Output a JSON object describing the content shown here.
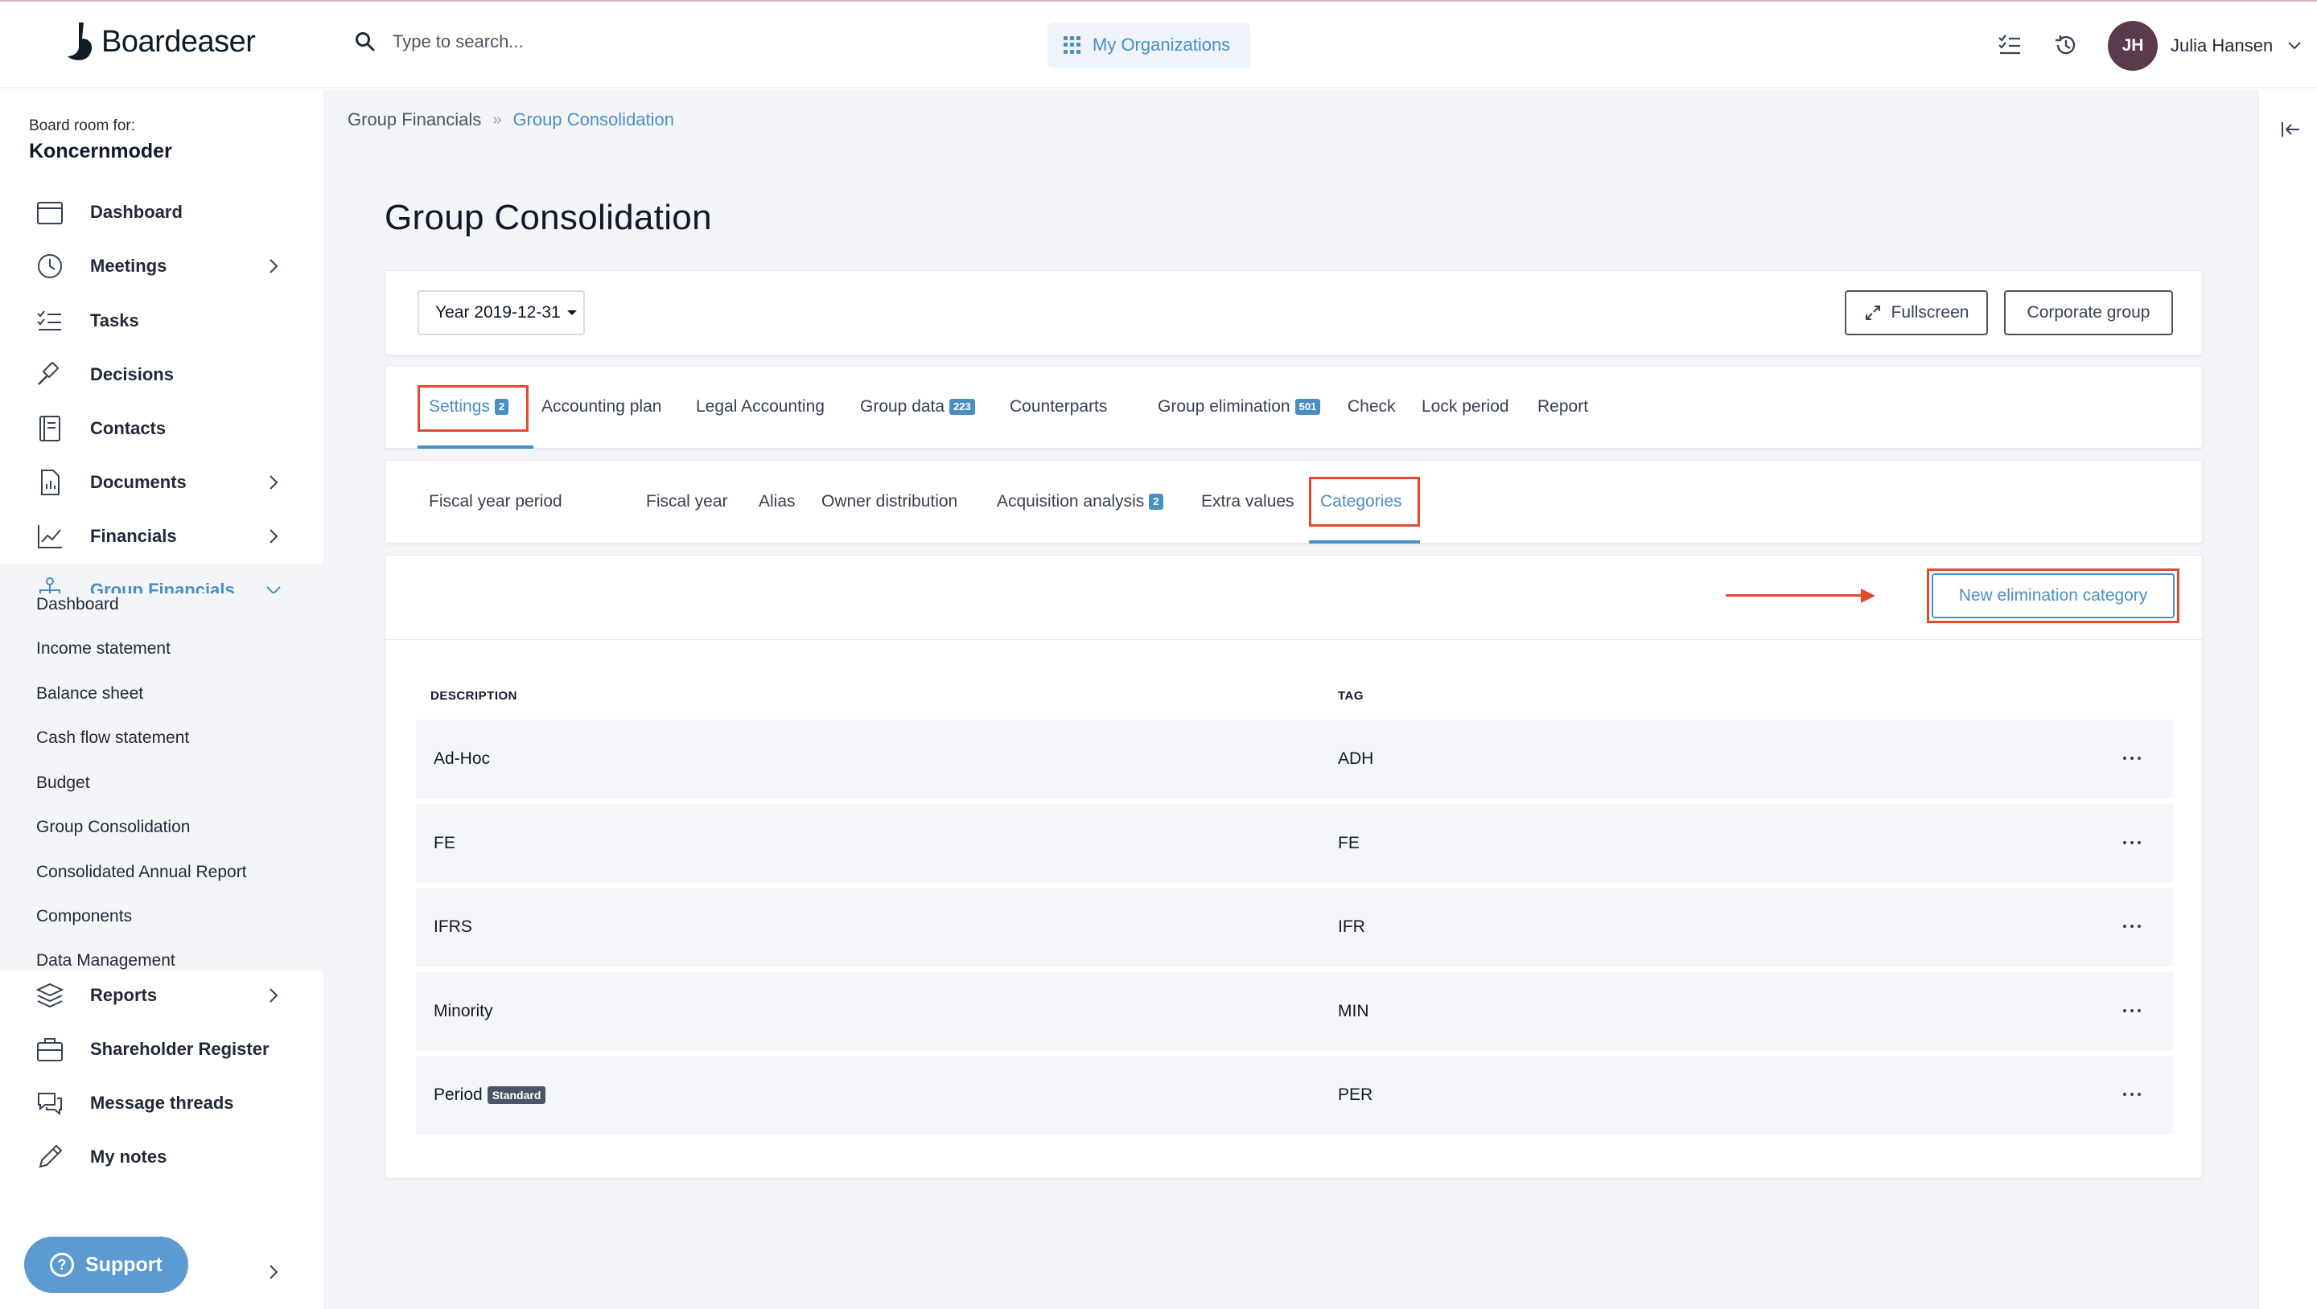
{
  "app": {
    "logo_text": "Boardeaser"
  },
  "search": {
    "placeholder": "Type to search..."
  },
  "header": {
    "orgs_label": "My Organizations",
    "user_initials": "JH",
    "user_name": "Julia Hansen"
  },
  "sidebar": {
    "board_room_label": "Board room for:",
    "org_name": "Koncernmoder",
    "items": [
      {
        "label": "Dashboard",
        "icon": "calendar-icon"
      },
      {
        "label": "Meetings",
        "icon": "clock-icon"
      },
      {
        "label": "Tasks",
        "icon": "checklist-icon"
      },
      {
        "label": "Decisions",
        "icon": "gavel-icon"
      },
      {
        "label": "Contacts",
        "icon": "address-book-icon"
      },
      {
        "label": "Documents",
        "icon": "document-icon"
      },
      {
        "label": "Financials",
        "icon": "line-chart-icon"
      },
      {
        "label": "Group Financials",
        "icon": "org-chart-icon"
      },
      {
        "label": "Reports",
        "icon": "layers-icon"
      },
      {
        "label": "Shareholder Register",
        "icon": "briefcase-icon"
      },
      {
        "label": "Message threads",
        "icon": "chat-icon"
      },
      {
        "label": "My notes",
        "icon": "pencil-icon"
      }
    ],
    "sub_items": [
      "Dashboard",
      "Income statement",
      "Balance sheet",
      "Cash flow statement",
      "Budget",
      "Group Consolidation",
      "Consolidated Annual Report",
      "Components",
      "Data Management"
    ],
    "support_label": "Support"
  },
  "breadcrumb": {
    "parent": "Group Financials",
    "current": "Group Consolidation"
  },
  "page": {
    "title": "Group Consolidation"
  },
  "toolbar": {
    "year_select": "Year 2019-12-31",
    "fullscreen_label": "Fullscreen",
    "corporate_group_label": "Corporate group"
  },
  "tabs": [
    {
      "label": "Settings",
      "badge": "2"
    },
    {
      "label": "Accounting plan"
    },
    {
      "label": "Legal Accounting"
    },
    {
      "label": "Group data",
      "badge": "223"
    },
    {
      "label": "Counterparts"
    },
    {
      "label": "Group elimination",
      "badge": "501"
    },
    {
      "label": "Check"
    },
    {
      "label": "Lock period"
    },
    {
      "label": "Report"
    }
  ],
  "subtabs": [
    {
      "label": "Fiscal year period"
    },
    {
      "label": "Fiscal year"
    },
    {
      "label": "Alias"
    },
    {
      "label": "Owner distribution"
    },
    {
      "label": "Acquisition analysis",
      "badge": "2"
    },
    {
      "label": "Extra values"
    },
    {
      "label": "Categories"
    }
  ],
  "categories": {
    "new_button_label": "New elimination category",
    "columns": {
      "description": "DESCRIPTION",
      "tag": "TAG"
    },
    "rows": [
      {
        "description": "Ad-Hoc",
        "tag": "ADH"
      },
      {
        "description": "FE",
        "tag": "FE"
      },
      {
        "description": "IFRS",
        "tag": "IFR"
      },
      {
        "description": "Minority",
        "tag": "MIN"
      },
      {
        "description": "Period",
        "badge": "Standard",
        "tag": "PER"
      }
    ]
  },
  "colors": {
    "accent": "#4a8fc4",
    "highlight": "#e34a30"
  }
}
